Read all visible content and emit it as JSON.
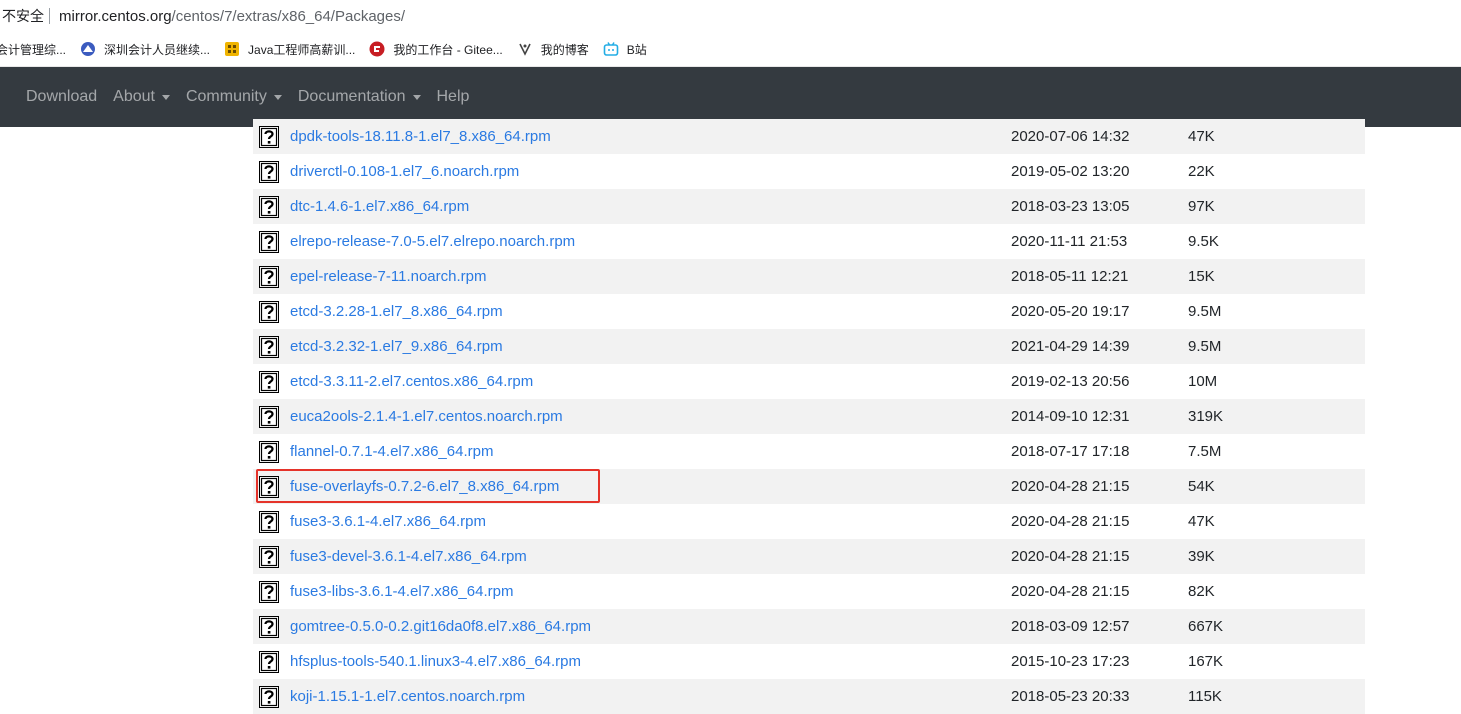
{
  "address_bar": {
    "security_label": "不安全",
    "url_host": "mirror.centos.org",
    "url_path": "/centos/7/extras/x86_64/Packages/"
  },
  "bookmarks": [
    {
      "label": "会计管理综...",
      "icon": "bookmark-icon"
    },
    {
      "label": "深圳会计人员继续...",
      "icon": "globe-icon"
    },
    {
      "label": "Java工程师高薪训...",
      "icon": "folder-icon"
    },
    {
      "label": "我的工作台 - Gitee...",
      "icon": "gitee-icon"
    },
    {
      "label": "我的博客",
      "icon": "blog-icon"
    },
    {
      "label": "B站",
      "icon": "bilibili-icon"
    }
  ],
  "navbar": {
    "items": [
      {
        "label": "Download",
        "dropdown": false
      },
      {
        "label": "About",
        "dropdown": true
      },
      {
        "label": "Community",
        "dropdown": true
      },
      {
        "label": "Documentation",
        "dropdown": true
      },
      {
        "label": "Help",
        "dropdown": false
      }
    ]
  },
  "files": [
    {
      "name": "dpdk-tools-18.11.8-1.el7_8.x86_64.rpm",
      "date": "2020-07-06 14:32",
      "size": "47K"
    },
    {
      "name": "driverctl-0.108-1.el7_6.noarch.rpm",
      "date": "2019-05-02 13:20",
      "size": "22K"
    },
    {
      "name": "dtc-1.4.6-1.el7.x86_64.rpm",
      "date": "2018-03-23 13:05",
      "size": "97K"
    },
    {
      "name": "elrepo-release-7.0-5.el7.elrepo.noarch.rpm",
      "date": "2020-11-11 21:53",
      "size": "9.5K"
    },
    {
      "name": "epel-release-7-11.noarch.rpm",
      "date": "2018-05-11 12:21",
      "size": "15K"
    },
    {
      "name": "etcd-3.2.28-1.el7_8.x86_64.rpm",
      "date": "2020-05-20 19:17",
      "size": "9.5M"
    },
    {
      "name": "etcd-3.2.32-1.el7_9.x86_64.rpm",
      "date": "2021-04-29 14:39",
      "size": "9.5M"
    },
    {
      "name": "etcd-3.3.11-2.el7.centos.x86_64.rpm",
      "date": "2019-02-13 20:56",
      "size": "10M"
    },
    {
      "name": "euca2ools-2.1.4-1.el7.centos.noarch.rpm",
      "date": "2014-09-10 12:31",
      "size": "319K"
    },
    {
      "name": "flannel-0.7.1-4.el7.x86_64.rpm",
      "date": "2018-07-17 17:18",
      "size": "7.5M"
    },
    {
      "name": "fuse-overlayfs-0.7.2-6.el7_8.x86_64.rpm",
      "date": "2020-04-28 21:15",
      "size": "54K"
    },
    {
      "name": "fuse3-3.6.1-4.el7.x86_64.rpm",
      "date": "2020-04-28 21:15",
      "size": "47K"
    },
    {
      "name": "fuse3-devel-3.6.1-4.el7.x86_64.rpm",
      "date": "2020-04-28 21:15",
      "size": "39K"
    },
    {
      "name": "fuse3-libs-3.6.1-4.el7.x86_64.rpm",
      "date": "2020-04-28 21:15",
      "size": "82K"
    },
    {
      "name": "gomtree-0.5.0-0.2.git16da0f8.el7.x86_64.rpm",
      "date": "2018-03-09 12:57",
      "size": "667K"
    },
    {
      "name": "hfsplus-tools-540.1.linux3-4.el7.x86_64.rpm",
      "date": "2015-10-23 17:23",
      "size": "167K"
    },
    {
      "name": "koji-1.15.1-1.el7.centos.noarch.rpm",
      "date": "2018-05-23 20:33",
      "size": "115K"
    }
  ],
  "highlighted_file": "fuse-overlayfs-0.7.2-6.el7_8.x86_64.rpm",
  "colors": {
    "navbar_bg": "#343a40",
    "link": "#2a7ae2",
    "highlight_border": "#e5332a",
    "row_stripe": "#f2f2f2"
  }
}
